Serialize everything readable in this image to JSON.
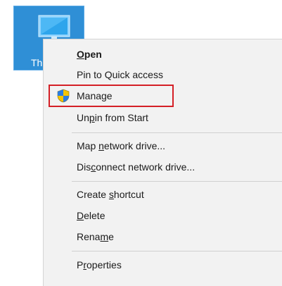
{
  "desktop": {
    "icon_label": "Th",
    "icon_name": "this-pc-monitor-icon",
    "icon_color": "#2f8fd6"
  },
  "context_menu": {
    "items": [
      {
        "label": "Open",
        "access_key": "O",
        "bold": true
      },
      {
        "label": "Pin to Quick access",
        "access_key": ""
      },
      {
        "label": "Manage",
        "access_key": "",
        "icon": "uac-shield-icon"
      },
      {
        "label": "Unpin from Start",
        "access_key": "p"
      },
      {
        "label": "Map network drive...",
        "access_key": "n"
      },
      {
        "label": "Disconnect network drive...",
        "access_key": "c"
      },
      {
        "label": "Create shortcut",
        "access_key": "s"
      },
      {
        "label": "Delete",
        "access_key": "D"
      },
      {
        "label": "Rename",
        "access_key": "m"
      },
      {
        "label": "Properties",
        "access_key": "r"
      }
    ]
  },
  "annotation": {
    "highlight_color": "#d41f26",
    "highlight_target": "Manage"
  }
}
